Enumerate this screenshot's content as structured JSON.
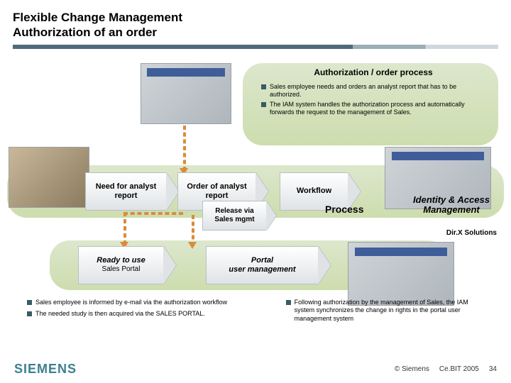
{
  "header": {
    "title_line1": "Flexible Change Management",
    "title_line2": "Authorization of an order"
  },
  "section": {
    "auth_heading": "Authorization / order process",
    "top_bullets": [
      "Sales employee needs and orders an analyst report that has to be authorized.",
      "The IAM system handles the authorization process and automatically forwards the request to the management of Sales."
    ]
  },
  "flow": {
    "chev1": "Need for analyst report",
    "chev2": "Order of analyst report",
    "chev3": "Workflow",
    "chev4": "Release via Sales mgmt",
    "chev5_main": "Ready to use",
    "chev5_sub": "Sales Portal",
    "chev6_line1": "Portal",
    "chev6_line2": "user management",
    "process_label": "Process",
    "iam_label": "Identity & Access Management",
    "dirx_label": "Dir.X Solutions"
  },
  "bottom": {
    "left": [
      "Sales employee is informed by e-mail via the authorization workflow",
      "The needed study is then acquired via the SALES PORTAL."
    ],
    "right": [
      "Following authorization by the management of Sales, the IAM system synchronizes the change in rights in the portal user management system"
    ]
  },
  "footer": {
    "logo": "SIEMENS",
    "copyright": "© Siemens",
    "event": "Ce.BIT 2005",
    "page": "34"
  }
}
